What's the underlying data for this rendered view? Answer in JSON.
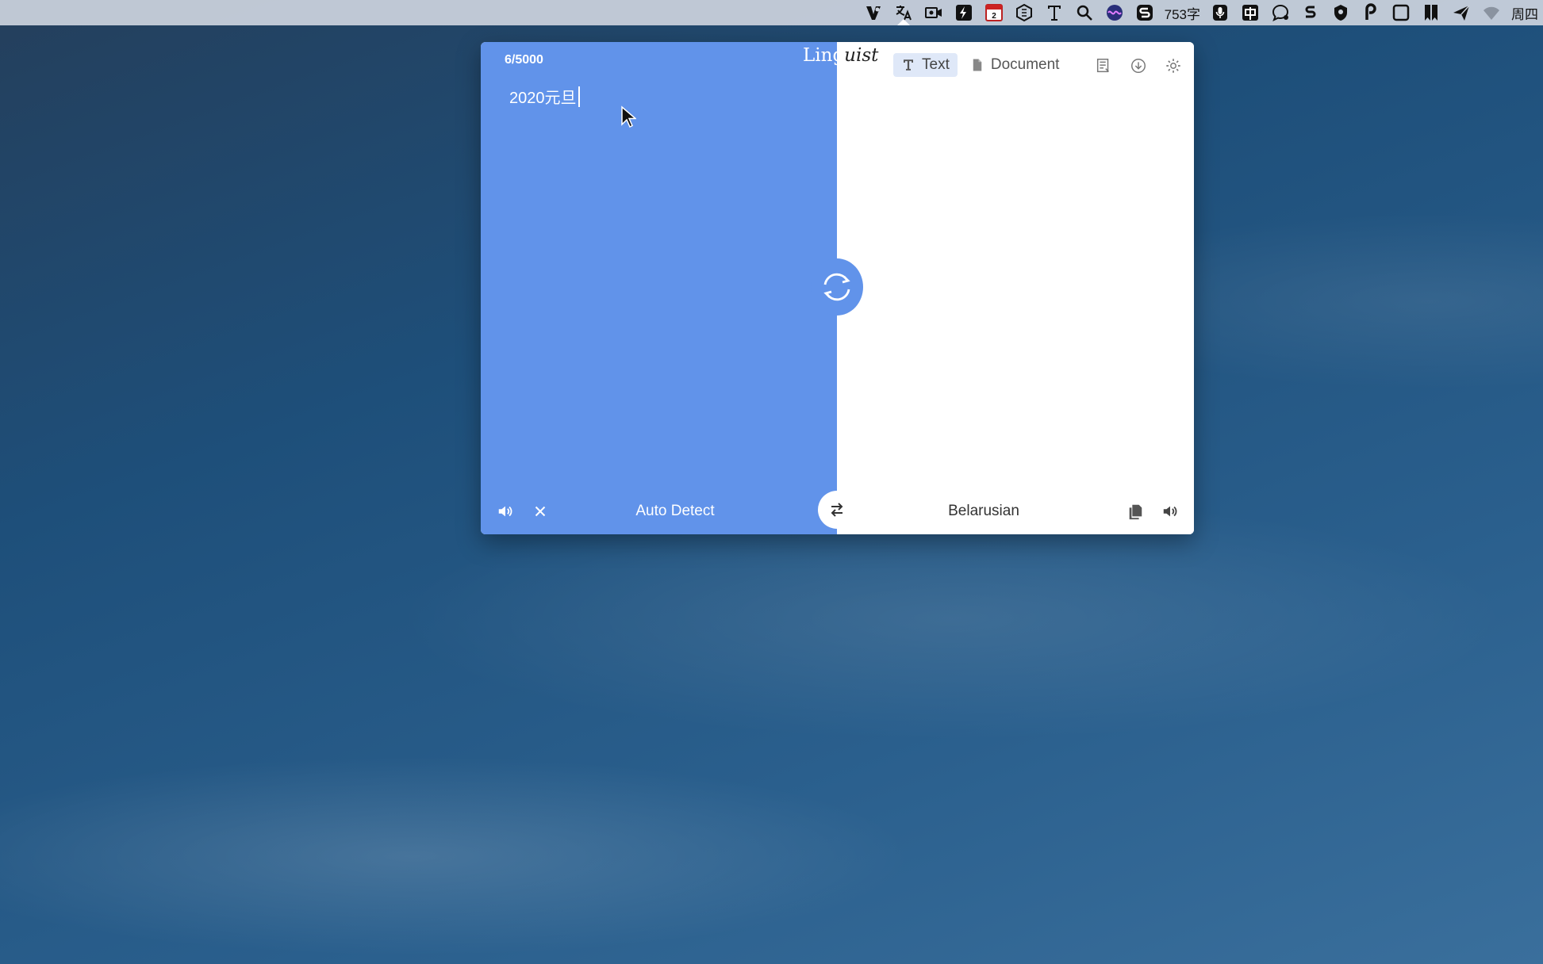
{
  "menubar": {
    "word_count": "753字",
    "day": "周四",
    "icons": [
      "vivaldi-icon",
      "translate-icon",
      "screen-record-icon",
      "bolt-icon",
      "calendar-icon",
      "hexagon-icon",
      "text-icon",
      "search-icon",
      "siri-icon",
      "scribble-icon",
      "microphone-icon",
      "input-method-icon",
      "chat-icon",
      "s-icon",
      "shield-icon",
      "p-icon",
      "square-icon",
      "bookmark-icon",
      "send-icon",
      "wifi-icon"
    ],
    "calendar_day": "2"
  },
  "app": {
    "title_left": "Ling",
    "title_right": "uist"
  },
  "source": {
    "char_count": "6/5000",
    "text": "2020元旦",
    "language": "Auto Detect"
  },
  "target": {
    "language": "Belarusian"
  },
  "tabs": [
    {
      "label": "Text",
      "icon": "text-icon",
      "active": true
    },
    {
      "label": "Document",
      "icon": "document-icon",
      "active": false
    }
  ],
  "toolbar_icons": [
    "history-icon",
    "download-icon",
    "settings-icon"
  ],
  "colors": {
    "accent": "#6193ea",
    "tab_active_bg": "#dfe8f8"
  }
}
